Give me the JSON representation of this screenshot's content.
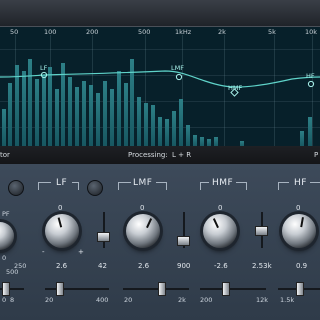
{
  "display": {
    "freq_labels": [
      "50",
      "100",
      "200",
      "500",
      "1kHz",
      "2k",
      "5k",
      "10k"
    ],
    "bands": [
      "LF",
      "LMF",
      "HMF",
      "HF"
    ]
  },
  "status": {
    "left": "tor",
    "processing_label": "Processing:",
    "processing_value": "L + R",
    "right": "P"
  },
  "lf": {
    "title": "LF",
    "gain_max": "0",
    "gain_low": "-",
    "gain_high": "+",
    "gain_value": "2.6",
    "freq_value": "42",
    "min": "20",
    "max": "400"
  },
  "lmf": {
    "title": "LMF",
    "gain_max": "0",
    "gain_value": "2.6",
    "freq_value": "900",
    "min": "20",
    "max": "2k"
  },
  "hmf": {
    "title": "HMF",
    "gain_max": "0",
    "gain_value": "-2.6",
    "freq_value": "2.53k",
    "min": "200",
    "max": "12k"
  },
  "hf": {
    "title": "HF",
    "gain_max": "0",
    "gain_value": "0.9",
    "min": "1.5k",
    "max": ""
  },
  "left_partial": {
    "label": "PF",
    "low": "0",
    "mid": "250",
    "bottom": "500",
    "bl": "0",
    "bl2": "8"
  },
  "colors": {
    "accent": "#5fd3c9",
    "panel": "#36424f",
    "display": "#07202a"
  }
}
